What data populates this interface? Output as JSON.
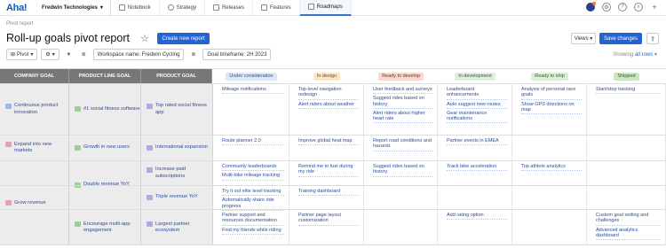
{
  "nav": {
    "logo": "Aha!",
    "workspace": "Fredwin Technologies",
    "tabs": [
      {
        "label": "Notebook"
      },
      {
        "label": "Strategy"
      },
      {
        "label": "Releases"
      },
      {
        "label": "Features"
      },
      {
        "label": "Roadmaps"
      }
    ]
  },
  "page": {
    "breadcrumb": "Pivot report",
    "title": "Roll-up goals pivot report",
    "create_button": "Create new report",
    "views_button": "Views",
    "save_button": "Save changes"
  },
  "filters": {
    "pivot": "Pivot",
    "workspace_chip": "Workspace name: Fredwin Cycling",
    "timeframe_chip": "Goal timeframe: 2H 2023",
    "showing_prefix": "Showing",
    "showing_value": "all rows"
  },
  "headers": {
    "company_goal": "COMPANY GOAL",
    "product_line_goal": "PRODUCT LINE GOAL",
    "product_goal": "PRODUCT GOAL"
  },
  "statuses": [
    {
      "label": "Under consideration",
      "bg": "#dde6f7",
      "color": "#3a4f7a"
    },
    {
      "label": "In design",
      "bg": "#fbe6c8",
      "color": "#6b4a1a"
    },
    {
      "label": "Ready to develop",
      "bg": "#f8d9cf",
      "color": "#6b3322"
    },
    {
      "label": "In development",
      "bg": "#e2eee0",
      "color": "#355432"
    },
    {
      "label": "Ready to ship",
      "bg": "#dcefd6",
      "color": "#345a2b"
    },
    {
      "label": "Shipped",
      "bg": "#cde7c4",
      "color": "#2f5a24"
    }
  ],
  "rows": {
    "r1": {
      "company": "Continuous product innovation",
      "product_line": "#1 social fitness software",
      "product": "Top rated social fitness app",
      "c0": [
        "Mileage notifications"
      ],
      "c1": [
        "Top-level navigation redesign",
        "Alert riders about weather"
      ],
      "c2": [
        "User feedback and surveys",
        "Suggest rides based on history",
        "Alert riders about higher heart rate"
      ],
      "c3": [
        "Leaderboard enhancements",
        "Auto suggest new routes",
        "Gear maintenance notifications"
      ],
      "c4": [
        "Analysis of personal race goals",
        "Show GPS directions on map"
      ],
      "c5": [
        "Start/stop tracking"
      ]
    },
    "r2": {
      "company": "Expand into new markets",
      "product_line": "Growth in new users",
      "product": "International expansion",
      "c0": [
        "Route planner 2.0"
      ],
      "c1": [
        "Improve global heat map"
      ],
      "c2": [
        "Report road conditions and hazards"
      ],
      "c3": [
        "Partner events in EMEA"
      ],
      "c4": [],
      "c5": []
    },
    "r3": {
      "company": "Grow revenue",
      "product_line": "Double revenue YoY",
      "product": "Increase paid subscriptions",
      "c0": [
        "Community leaderboards",
        "Multi-bike mileage tracking"
      ],
      "c1": [
        "Remind me to fuel during my ride"
      ],
      "c2": [
        "Suggest rides based on history"
      ],
      "c3": [
        "Track bike acceleration"
      ],
      "c4": [
        "Top athlete analytics"
      ],
      "c5": []
    },
    "r4": {
      "product": "Triple revenue YoY",
      "c0": [
        "Try it out elite level tracking",
        "Automatically share ride progress"
      ],
      "c1": [
        "Training dashboard"
      ],
      "c2": [],
      "c3": [],
      "c4": [],
      "c5": []
    },
    "r5": {
      "product_line": "Encourage multi-app engagement",
      "product": "Largest partner ecosystem",
      "c0": [
        "Partner support and resources documentation",
        "Find my friends while riding"
      ],
      "c1": [
        "Partner page layout customization"
      ],
      "c2": [],
      "c3": [
        "Add rating option"
      ],
      "c4": [],
      "c5": [
        "Custom goal setting and challenges",
        "Advanced analytics dashboard"
      ]
    }
  }
}
